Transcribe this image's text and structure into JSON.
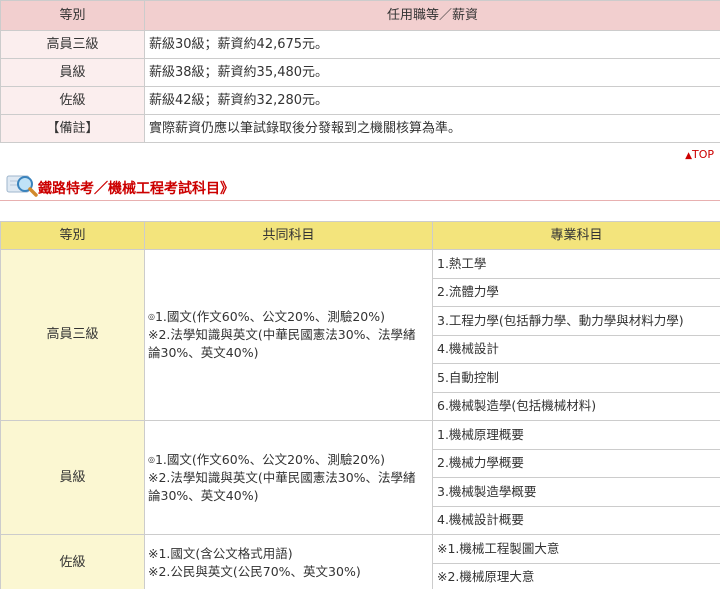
{
  "salary_table": {
    "header": {
      "level": "等別",
      "salary": "任用職等／薪資"
    },
    "rows": [
      {
        "level": "高員三級",
        "salary": "薪級30級；薪資約42,675元。"
      },
      {
        "level": "員級",
        "salary": "薪級38級；薪資約35,480元。"
      },
      {
        "level": "佐級",
        "salary": "薪級42級；薪資約32,280元。"
      },
      {
        "level": "【備註】",
        "salary": "實際薪資仍應以筆試錄取後分發報到之機關核算為準。"
      }
    ]
  },
  "top_link": {
    "arrow": "▲",
    "label": "TOP"
  },
  "section": {
    "icon": "magnifier-icon",
    "title": "鐵路特考／機械工程考試科目》"
  },
  "exam_table": {
    "header": {
      "level": "等別",
      "common": "共同科目",
      "special": "專業科目"
    },
    "groups": [
      {
        "level": "高員三級",
        "common_bullet": "◎",
        "common": [
          "1.國文(作文60%、公文20%、測驗20%)",
          "※2.法學知識與英文(中華民國憲法30%、法學緒論30%、英文40%)"
        ],
        "special": [
          "1.熱工學",
          "2.流體力學",
          "3.工程力學(包括靜力學、動力學與材料力學)",
          "4.機械設計",
          "5.自動控制",
          "6.機械製造學(包括機械材料)"
        ]
      },
      {
        "level": "員級",
        "common_bullet": "◎",
        "common": [
          "1.國文(作文60%、公文20%、測驗20%)",
          "※2.法學知識與英文(中華民國憲法30%、法學緒論30%、英文40%)"
        ],
        "special": [
          "1.機械原理概要",
          "2.機械力學概要",
          "3.機械製造學概要",
          "4.機械設計概要"
        ]
      },
      {
        "level": "佐級",
        "common_bullet": "",
        "common": [
          "※1.國文(含公文格式用語)",
          "※2.公民與英文(公民70%、英文30%)"
        ],
        "special": [
          "※1.機械工程製圖大意",
          "※2.機械原理大意"
        ]
      }
    ]
  }
}
